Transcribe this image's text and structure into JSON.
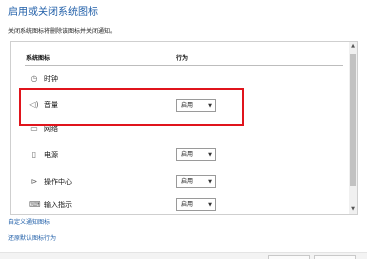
{
  "header": {
    "title": "启用或关闭系统图标",
    "description": "关闭系统图标将删除该图标并关闭通知。"
  },
  "table": {
    "columns": {
      "name": "系统图标",
      "action": "行为"
    },
    "rows": [
      {
        "icon": "clock-icon",
        "label": "时钟",
        "value": ""
      },
      {
        "icon": "volume-icon",
        "label": "音量",
        "value": "启用"
      },
      {
        "icon": "network-icon",
        "label": "网络",
        "value": ""
      },
      {
        "icon": "power-icon",
        "label": "电源",
        "value": "启用"
      },
      {
        "icon": "action-center-icon",
        "label": "操作中心",
        "value": "启用"
      },
      {
        "icon": "input-indicator-icon",
        "label": "输入指示",
        "value": "启用"
      }
    ]
  },
  "links": {
    "customize_notifications": "自定义通知图标",
    "restore_default": "还原默认图标行为"
  },
  "colors": {
    "title_link": "#1f5ea8",
    "highlight_box": "#e0141c"
  }
}
